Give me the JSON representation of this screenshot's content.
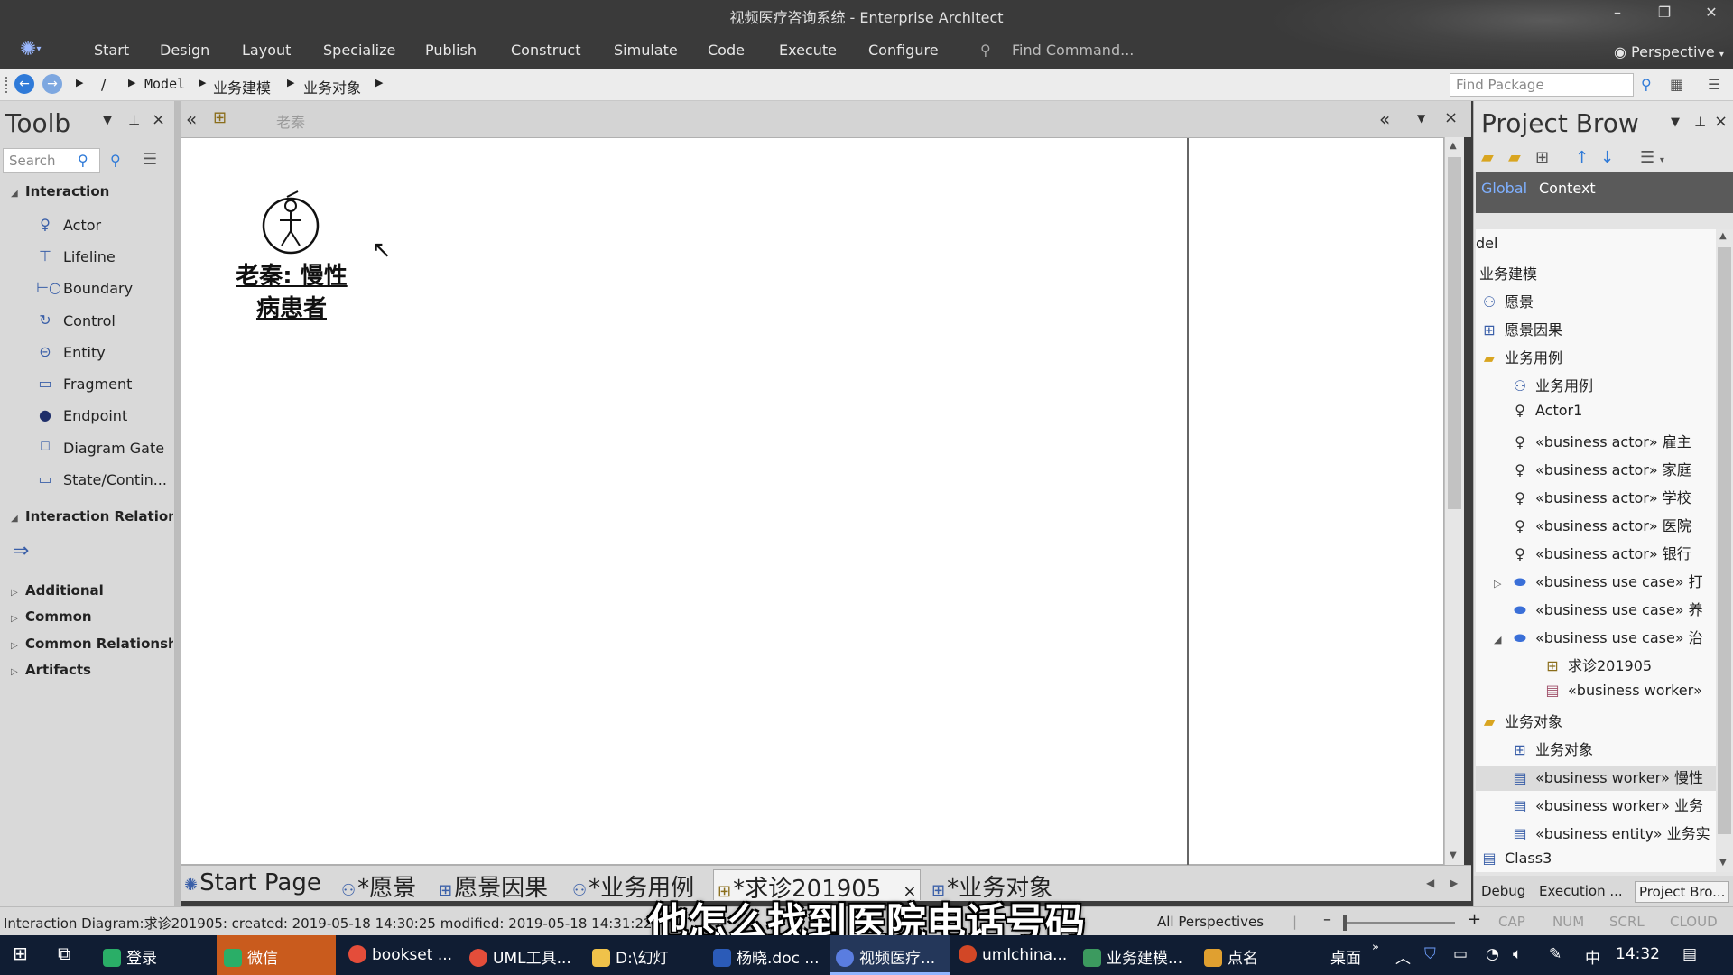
{
  "window": {
    "title": "视频医疗咨询系统 - Enterprise Architect",
    "perspective_label": "Perspective"
  },
  "menu": {
    "items": [
      "Start",
      "Design",
      "Layout",
      "Specialize",
      "Publish",
      "Construct",
      "Simulate",
      "Code",
      "Execute",
      "Configure"
    ],
    "find_command": "Find Command..."
  },
  "breadcrumb": {
    "root": "/",
    "items": [
      "Model",
      "业务建模",
      "业务对象"
    ],
    "find_package_placeholder": "Find Package"
  },
  "toolbox": {
    "title": "Toolb",
    "search_placeholder": "Search",
    "group_interaction": "Interaction",
    "items": [
      "Actor",
      "Lifeline",
      "Boundary",
      "Control",
      "Entity",
      "Fragment",
      "Endpoint",
      "Diagram Gate",
      "State/Contin..."
    ],
    "group_relations": "Interaction Relation:",
    "relation_icon": "arrow-right-icon",
    "collapsed_groups": [
      "Additional",
      "Common",
      "Common Relationsh",
      "Artifacts"
    ]
  },
  "diagram": {
    "header_label": "老秦",
    "actor_name_line1": "老秦: 慢性",
    "actor_name_line2": "病患者"
  },
  "tabs": [
    "Start Page",
    "*愿景",
    "愿景因果",
    "*业务用例",
    "*求诊201905",
    "*业务对象"
  ],
  "active_tab_index": 4,
  "project_browser": {
    "title": "Project Brow",
    "scope_global": "Global",
    "scope_context": "Context",
    "nodes": [
      {
        "label": "del",
        "icon": ""
      },
      {
        "label": "业务建模",
        "icon": ""
      },
      {
        "label": "愿景",
        "icon": "usecase-diagram-icon"
      },
      {
        "label": "愿景因果",
        "icon": "class-diagram-icon"
      },
      {
        "label": "业务用例",
        "icon": "folder-icon"
      },
      {
        "label": "业务用例",
        "icon": "usecase-diagram-icon"
      },
      {
        "label": "Actor1",
        "icon": "actor-icon"
      },
      {
        "label": "«business actor» 雇主",
        "icon": "actor-icon"
      },
      {
        "label": "«business actor» 家庭",
        "icon": "actor-icon"
      },
      {
        "label": "«business actor» 学校",
        "icon": "actor-icon"
      },
      {
        "label": "«business actor» 医院",
        "icon": "actor-icon"
      },
      {
        "label": "«business actor» 银行",
        "icon": "actor-icon"
      },
      {
        "label": "«business use case» 打",
        "icon": "usecase-icon"
      },
      {
        "label": "«business use case» 养",
        "icon": "usecase-icon"
      },
      {
        "label": "«business use case» 治",
        "icon": "usecase-icon"
      },
      {
        "label": "求诊201905",
        "icon": "interaction-diagram-icon"
      },
      {
        "label": "«business worker»",
        "icon": "class-icon"
      },
      {
        "label": "业务对象",
        "icon": "folder-icon"
      },
      {
        "label": "业务对象",
        "icon": "class-diagram-icon"
      },
      {
        "label": "«business worker» 慢性",
        "icon": "class-icon"
      },
      {
        "label": "«business worker» 业务",
        "icon": "class-icon"
      },
      {
        "label": "«business entity» 业务实",
        "icon": "class-icon"
      },
      {
        "label": "Class3",
        "icon": "class-icon"
      }
    ],
    "bottom_tabs": [
      "Debug",
      "Execution ...",
      "Project Bro..."
    ]
  },
  "status": {
    "info": "Interaction Diagram:求诊201905:  created: 2019-05-18 14:30:25  modified: 2019-05-18 14:31:22",
    "perspectives": "All Perspectives",
    "indicators": [
      "CAP",
      "NUM",
      "SCRL",
      "CLOUD"
    ]
  },
  "subtitle": "他怎么找到医院电话号码",
  "taskbar": {
    "items": [
      {
        "label": "登录",
        "color": "#2aae67"
      },
      {
        "label": "微信",
        "color": "#2aae67"
      },
      {
        "label": "bookset ...",
        "color": "#e44d3a"
      },
      {
        "label": "UML工具...",
        "color": "#e44d3a"
      },
      {
        "label": "D:\\幻灯",
        "color": "#f0c24a"
      },
      {
        "label": "杨晓.doc ...",
        "color": "#2b5bb8"
      },
      {
        "label": "视频医疗...",
        "color": "#5a7de0"
      },
      {
        "label": "umlchina...",
        "color": "#d24726"
      },
      {
        "label": "业务建模...",
        "color": "#3c9a5f"
      },
      {
        "label": "点名",
        "color": "#e0a030"
      }
    ],
    "desktop": "桌面",
    "ime": "中",
    "clock": "14:32"
  }
}
